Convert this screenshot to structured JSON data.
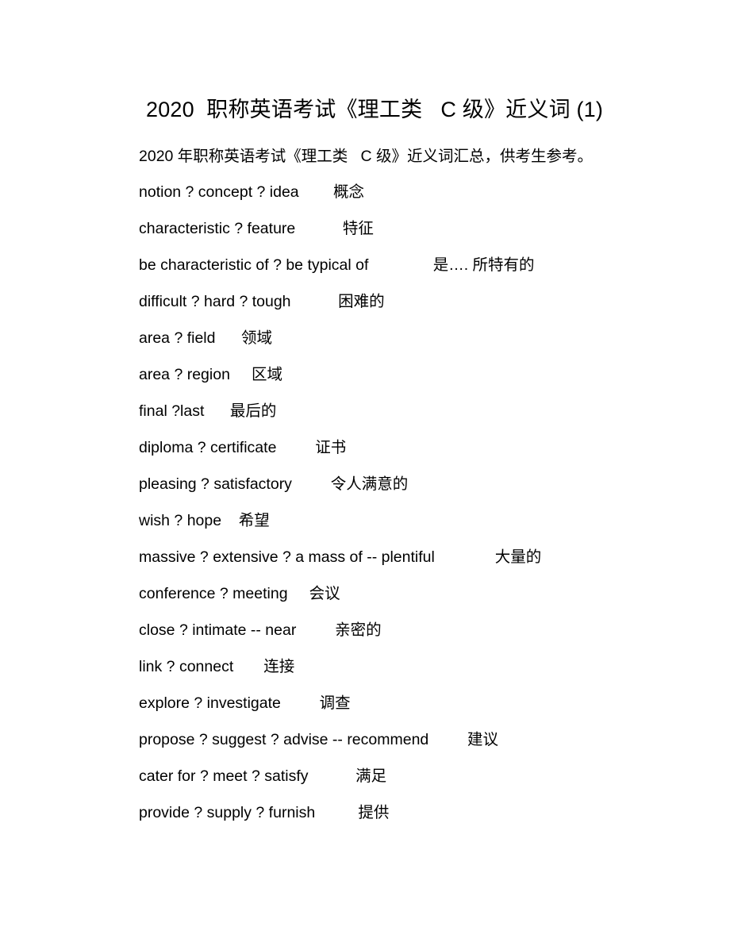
{
  "document": {
    "title": "2020  职称英语考试《理工类   C 级》近义词 (1)",
    "subtitle": "2020 年职称英语考试《理工类   C 级》近义词汇总，供考生参考。"
  },
  "entries": [
    {
      "terms": "notion ? concept ? idea",
      "gap": "        ",
      "gloss": "概念"
    },
    {
      "terms": "characteristic ? feature",
      "gap": "           ",
      "gloss": "特征"
    },
    {
      "terms": "be characteristic of ? be typical of",
      "gap": "               ",
      "gloss": "是…. 所特有的"
    },
    {
      "terms": "difficult ? hard ? tough",
      "gap": "           ",
      "gloss": "困难的"
    },
    {
      "terms": "area ? field",
      "gap": "      ",
      "gloss": "领域"
    },
    {
      "terms": "area ? region",
      "gap": "     ",
      "gloss": "区域"
    },
    {
      "terms": "final ?last",
      "gap": "      ",
      "gloss": "最后的"
    },
    {
      "terms": "diploma ? certificate",
      "gap": "         ",
      "gloss": "证书"
    },
    {
      "terms": "pleasing ? satisfactory",
      "gap": "         ",
      "gloss": "令人满意的"
    },
    {
      "terms": "wish ? hope",
      "gap": "    ",
      "gloss": "希望"
    },
    {
      "terms": "massive ? extensive ? a mass of -- plentiful",
      "gap": "              ",
      "gloss": "大量的"
    },
    {
      "terms": "conference ? meeting",
      "gap": "     ",
      "gloss": "会议"
    },
    {
      "terms": "close ? intimate -- near",
      "gap": "         ",
      "gloss": "亲密的"
    },
    {
      "terms": "link ? connect",
      "gap": "       ",
      "gloss": "连接"
    },
    {
      "terms": "explore ? investigate",
      "gap": "         ",
      "gloss": "调查"
    },
    {
      "terms": "propose ? suggest ? advise -- recommend",
      "gap": "         ",
      "gloss": "建议"
    },
    {
      "terms": "cater for ? meet ? satisfy",
      "gap": "           ",
      "gloss": "满足"
    },
    {
      "terms": "provide ? supply ? furnish",
      "gap": "          ",
      "gloss": "提供"
    }
  ]
}
